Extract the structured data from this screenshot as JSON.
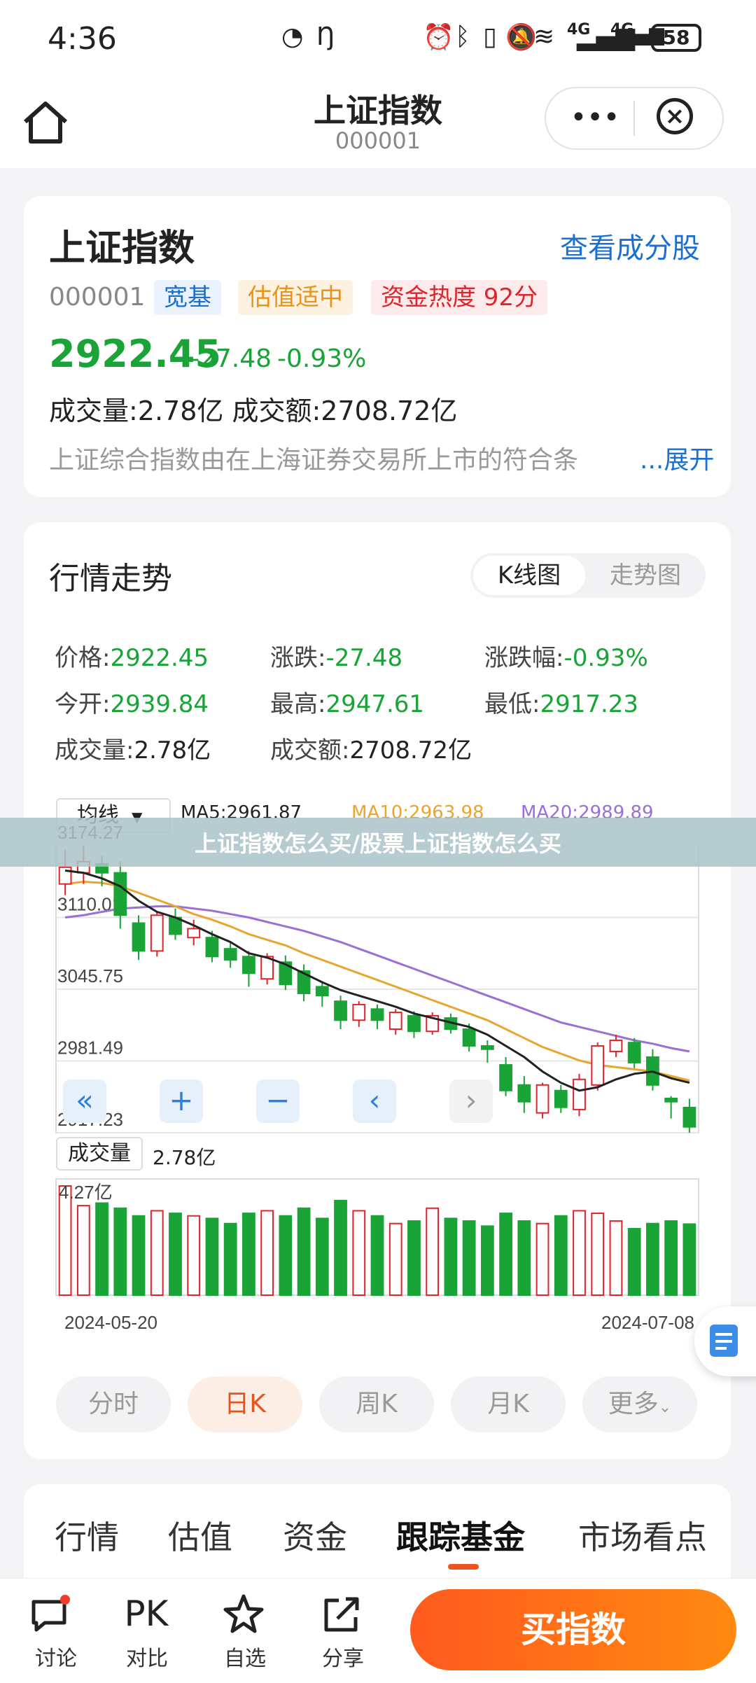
{
  "status_bar": {
    "time": "4:36",
    "battery": "58",
    "signal1": "4G",
    "signal2": "4G"
  },
  "header": {
    "title": "上证指数",
    "code": "000001"
  },
  "summary": {
    "name": "上证指数",
    "view_components": "查看成分股",
    "code": "000001",
    "tags": [
      "宽基",
      "估值适中",
      "资金热度 92分"
    ],
    "price": "2922.45",
    "change": "-27.48",
    "change_pct": "-0.93%",
    "volume_line": "成交量:2.78亿  成交额:2708.72亿",
    "description": "上证综合指数由在上海证券交易所上市的符合条",
    "expand": "...展开"
  },
  "trend": {
    "title": "行情走势",
    "seg_k": "K线图",
    "seg_trend": "走势图",
    "quotes": [
      {
        "label": "价格:",
        "value": "2922.45"
      },
      {
        "label": "涨跌:",
        "value": "-27.48"
      },
      {
        "label": "涨跌幅:",
        "value": "-0.93%"
      },
      {
        "label": "今开:",
        "value": "2939.84"
      },
      {
        "label": "最高:",
        "value": "2947.61"
      },
      {
        "label": "最低:",
        "value": "2917.23"
      },
      {
        "label": "成交量:",
        "value": "2.78亿"
      },
      {
        "label": "成交额:",
        "value": "2708.72亿"
      }
    ],
    "ma_select": "均线",
    "ma5": "MA5:2961.87",
    "ma10": "MA10:2963.98",
    "ma20": "MA20:2989.89",
    "volume_label": "成交量",
    "volume_value": "2.78亿",
    "vol_max": "4.27亿",
    "period": {
      "tabs": [
        "分时",
        "日K",
        "周K",
        "月K",
        "更多"
      ]
    }
  },
  "banner": "上证指数怎么买/股票上证指数怎么买",
  "sections": [
    "行情",
    "估值",
    "资金",
    "跟踪基金",
    "市场看点"
  ],
  "bottom_nav": [
    {
      "icon": "discuss-icon",
      "label": "讨论"
    },
    {
      "icon": "pk-icon",
      "glyph": "PK",
      "label": "对比"
    },
    {
      "icon": "star-icon",
      "label": "自选"
    },
    {
      "icon": "share-icon",
      "label": "分享"
    }
  ],
  "buy_label": "买指数",
  "colors": {
    "up": "#e0242c",
    "down": "#1aa336",
    "ma5": "#222222",
    "ma10": "#e8a630",
    "ma20": "#9b6fd6",
    "accent": "#1a6fd0",
    "buy": "#ff6a15"
  },
  "chart_data": {
    "type": "candlestick",
    "x_start": "2024-05-20",
    "x_end": "2024-07-08",
    "y_ticks": [
      2917.23,
      2981.49,
      3045.75,
      3110.01,
      3174.27
    ],
    "ylim": [
      2917.23,
      3174.27
    ],
    "candles": [
      {
        "o": 3140,
        "c": 3155,
        "h": 3170,
        "l": 3130
      },
      {
        "o": 3150,
        "c": 3160,
        "h": 3174,
        "l": 3140
      },
      {
        "o": 3158,
        "c": 3150,
        "h": 3165,
        "l": 3138
      },
      {
        "o": 3150,
        "c": 3112,
        "h": 3160,
        "l": 3100
      },
      {
        "o": 3105,
        "c": 3080,
        "h": 3112,
        "l": 3072
      },
      {
        "o": 3080,
        "c": 3112,
        "h": 3115,
        "l": 3075
      },
      {
        "o": 3110,
        "c": 3095,
        "h": 3118,
        "l": 3090
      },
      {
        "o": 3092,
        "c": 3100,
        "h": 3108,
        "l": 3085
      },
      {
        "o": 3092,
        "c": 3075,
        "h": 3098,
        "l": 3070
      },
      {
        "o": 3082,
        "c": 3072,
        "h": 3088,
        "l": 3065
      },
      {
        "o": 3075,
        "c": 3060,
        "h": 3080,
        "l": 3048
      },
      {
        "o": 3055,
        "c": 3075,
        "h": 3078,
        "l": 3050
      },
      {
        "o": 3070,
        "c": 3050,
        "h": 3076,
        "l": 3045
      },
      {
        "o": 3062,
        "c": 3042,
        "h": 3068,
        "l": 3035
      },
      {
        "o": 3048,
        "c": 3040,
        "h": 3052,
        "l": 3030
      },
      {
        "o": 3035,
        "c": 3018,
        "h": 3040,
        "l": 3010
      },
      {
        "o": 3018,
        "c": 3032,
        "h": 3035,
        "l": 3012
      },
      {
        "o": 3028,
        "c": 3018,
        "h": 3032,
        "l": 3010
      },
      {
        "o": 3010,
        "c": 3025,
        "h": 3028,
        "l": 3005
      },
      {
        "o": 3022,
        "c": 3008,
        "h": 3026,
        "l": 3002
      },
      {
        "o": 3008,
        "c": 3022,
        "h": 3025,
        "l": 3005
      },
      {
        "o": 3020,
        "c": 3010,
        "h": 3024,
        "l": 3006
      },
      {
        "o": 3010,
        "c": 2995,
        "h": 3015,
        "l": 2990
      },
      {
        "o": 2995,
        "c": 2992,
        "h": 3000,
        "l": 2980
      },
      {
        "o": 2978,
        "c": 2955,
        "h": 2985,
        "l": 2950
      },
      {
        "o": 2960,
        "c": 2945,
        "h": 2968,
        "l": 2935
      },
      {
        "o": 2935,
        "c": 2960,
        "h": 2962,
        "l": 2930
      },
      {
        "o": 2955,
        "c": 2940,
        "h": 2960,
        "l": 2935
      },
      {
        "o": 2938,
        "c": 2965,
        "h": 2970,
        "l": 2932
      },
      {
        "o": 2960,
        "c": 2995,
        "h": 2998,
        "l": 2955
      },
      {
        "o": 2990,
        "c": 3000,
        "h": 3005,
        "l": 2985
      },
      {
        "o": 2998,
        "c": 2980,
        "h": 3002,
        "l": 2975
      },
      {
        "o": 2985,
        "c": 2960,
        "h": 2992,
        "l": 2955
      },
      {
        "o": 2948,
        "c": 2945,
        "h": 2950,
        "l": 2930
      },
      {
        "o": 2939.84,
        "c": 2922.45,
        "h": 2947.61,
        "l": 2917.23
      }
    ],
    "ma5": [
      3152,
      3150,
      3145,
      3138,
      3125,
      3115,
      3110,
      3103,
      3095,
      3088,
      3078,
      3074,
      3068,
      3060,
      3052,
      3045,
      3040,
      3035,
      3030,
      3024,
      3020,
      3016,
      3012,
      3005,
      2995,
      2985,
      2972,
      2962,
      2955,
      2958,
      2965,
      2970,
      2972,
      2966,
      2962
    ],
    "ma10": [
      3140,
      3142,
      3141,
      3138,
      3132,
      3126,
      3120,
      3113,
      3108,
      3102,
      3095,
      3090,
      3085,
      3078,
      3072,
      3066,
      3060,
      3054,
      3048,
      3042,
      3036,
      3030,
      3024,
      3018,
      3010,
      3002,
      2994,
      2988,
      2982,
      2978,
      2976,
      2974,
      2972,
      2968,
      2964
    ],
    "ma20": [
      3110,
      3112,
      3115,
      3118,
      3119,
      3120,
      3120,
      3118,
      3116,
      3113,
      3110,
      3106,
      3102,
      3098,
      3093,
      3088,
      3082,
      3076,
      3070,
      3064,
      3058,
      3052,
      3046,
      3040,
      3034,
      3028,
      3022,
      3016,
      3012,
      3008,
      3004,
      3000,
      2997,
      2993,
      2990
    ],
    "volumes": [
      4.27,
      3.5,
      3.6,
      3.4,
      3.1,
      3.3,
      3.2,
      3.1,
      3.0,
      2.8,
      3.2,
      3.3,
      3.1,
      3.4,
      3.0,
      3.7,
      3.3,
      3.1,
      2.8,
      2.9,
      3.4,
      3.0,
      2.9,
      2.7,
      3.2,
      2.9,
      2.8,
      3.1,
      3.3,
      3.2,
      2.9,
      2.6,
      2.8,
      2.9,
      2.78
    ]
  }
}
